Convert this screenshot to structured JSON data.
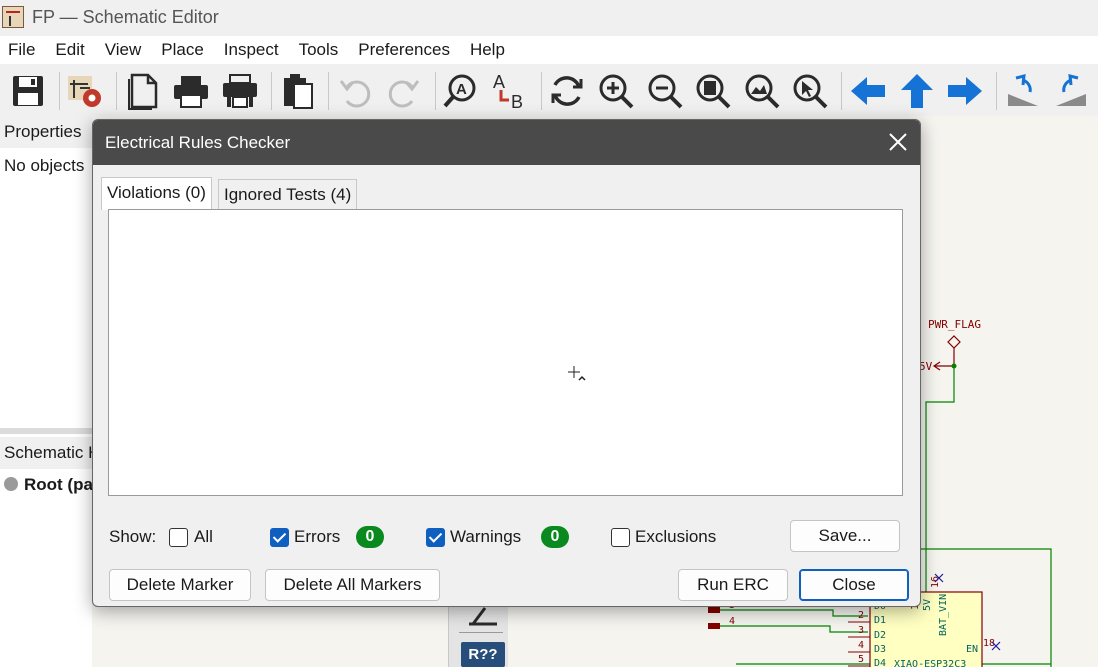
{
  "window": {
    "title": "FP — Schematic Editor"
  },
  "menu": [
    "File",
    "Edit",
    "View",
    "Place",
    "Inspect",
    "Tools",
    "Preferences",
    "Help"
  ],
  "toolbar": {
    "icons": [
      "save-icon",
      "schematic-setup-icon",
      "page-settings-icon",
      "print-icon",
      "plot-icon",
      "paste-icon",
      "undo-icon",
      "redo-icon",
      "find-icon",
      "find-replace-icon",
      "refresh-icon",
      "zoom-in-icon",
      "zoom-out-icon",
      "zoom-fit-icon",
      "zoom-objects-icon",
      "zoom-selection-icon",
      "navigate-back-icon",
      "navigate-up-icon",
      "navigate-forward-icon",
      "rotate-ccw-icon",
      "rotate-cw-icon"
    ]
  },
  "properties_panel": {
    "header": "Properties",
    "empty_text": "No objects"
  },
  "hierarchy_panel": {
    "header": "Schematic H",
    "root_label": "Root (pa"
  },
  "dialog": {
    "title": "Electrical Rules Checker",
    "tabs": [
      {
        "label": "Violations (0)",
        "active": true
      },
      {
        "label": "Ignored Tests (4)",
        "active": false
      }
    ],
    "show_label": "Show:",
    "filters": {
      "all": {
        "label": "All",
        "checked": false
      },
      "errors": {
        "label": "Errors",
        "checked": true,
        "count": "0"
      },
      "warnings": {
        "label": "Warnings",
        "checked": true,
        "count": "0"
      },
      "exclusions": {
        "label": "Exclusions",
        "checked": false
      }
    },
    "buttons": {
      "save": "Save...",
      "delete_marker": "Delete Marker",
      "delete_all_markers": "Delete All Markers",
      "run_erc": "Run ERC",
      "close": "Close"
    }
  },
  "schematic": {
    "pwr_flag": "PWR_FLAG",
    "net_5v": "5V",
    "pins": [
      "2",
      "3",
      "4",
      "5"
    ],
    "left_pins": [
      "3",
      "4"
    ],
    "pin_labels": [
      "D0",
      "D1",
      "D2",
      "D3",
      "D4"
    ],
    "chip_labels": [
      "5V",
      "BAT_VIN",
      "EN"
    ],
    "pin_numbers": [
      "1",
      "16",
      "18"
    ],
    "chip_name": "XIAO-ESP32C3",
    "ref_label": "R??"
  },
  "colors": {
    "dialog_title_bg": "#4a4a4a",
    "accent": "#0f5fc0",
    "badge": "#0a8a1e",
    "wire": "#008400",
    "pin": "#840000"
  }
}
